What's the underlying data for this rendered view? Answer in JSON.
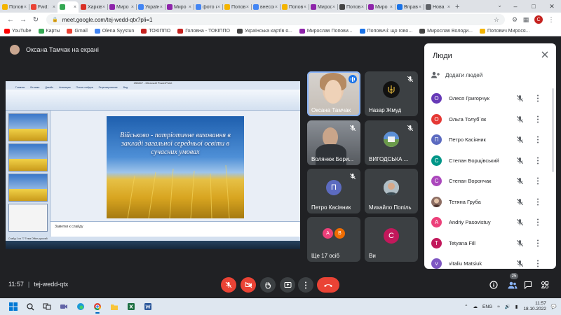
{
  "browser": {
    "tabs": [
      {
        "label": "Попов",
        "color": "#f4b400"
      },
      {
        "label": "Fwd:",
        "color": "#ea4335"
      },
      {
        "label": "",
        "color": "#34a853",
        "active": true
      },
      {
        "label": "Харків",
        "color": "#d93025"
      },
      {
        "label": "Миро",
        "color": "#8e24aa"
      },
      {
        "label": "Україн",
        "color": "#4285f4"
      },
      {
        "label": "Миро",
        "color": "#8e24aa"
      },
      {
        "label": "фото к",
        "color": "#4285f4"
      },
      {
        "label": "Попов",
        "color": "#f4b400"
      },
      {
        "label": "внесок",
        "color": "#4285f4"
      },
      {
        "label": "Попов",
        "color": "#f4b400"
      },
      {
        "label": "Мирос",
        "color": "#8e24aa"
      },
      {
        "label": "Попов",
        "color": "#444444"
      },
      {
        "label": "Миро",
        "color": "#8e24aa"
      },
      {
        "label": "Вправ",
        "color": "#1a73e8"
      },
      {
        "label": "Нова",
        "color": "#5f6368"
      }
    ],
    "tab_close": "×",
    "new_tab": "+",
    "url": "meet.google.com/tej-wedd-qtx?pli=1",
    "profile_initial": "C",
    "bookmarks": [
      {
        "label": "YouTube",
        "color": "#ff0000"
      },
      {
        "label": "Карты",
        "color": "#34a853"
      },
      {
        "label": "Gmail",
        "color": "#ea4335"
      },
      {
        "label": "Olena Syystun",
        "color": "#4285f4"
      },
      {
        "label": "ТОКІППО",
        "color": "#c5221f"
      },
      {
        "label": "Головна - ТОКІППО",
        "color": "#c5221f"
      },
      {
        "label": "Українська картів я...",
        "color": "#444444"
      },
      {
        "label": "Мирослав Попови...",
        "color": "#8e24aa"
      },
      {
        "label": "Поповичі: що гово...",
        "color": "#1a73e8"
      },
      {
        "label": "Мирослав Володи...",
        "color": "#444444"
      },
      {
        "label": "Попович Мирося...",
        "color": "#f4b400"
      }
    ]
  },
  "meet": {
    "presenter_label": "Оксана Тамчак на екрані",
    "meeting_time": "11:57",
    "meeting_code": "tej-wedd-qtx",
    "participants_count": "25",
    "accent_color": "#1a73e8",
    "danger_color": "#ea4335"
  },
  "shared_screen": {
    "ppt_window_title": "250847 - Microsoft PowerPoint",
    "ppt_tabs": [
      "Главная",
      "Вставка",
      "Дизайн",
      "Анимация",
      "Показ слайдов",
      "Рецензирование",
      "Вид"
    ],
    "slide_text": "Військово - патріотичне виховання в закладі загальної середньої освіти в сучасних умовах",
    "notes_placeholder": "Заметки к слайду",
    "status_text": "Слайд 1 из 77    Тема Office    русский"
  },
  "tiles": [
    {
      "name": "Оксана Тамчак",
      "kind": "video",
      "speaking": true
    },
    {
      "name": "Назар Жмуд",
      "kind": "emblem"
    },
    {
      "name": "Волянюк Бори...",
      "kind": "video2"
    },
    {
      "name": "ВИГОДСЬКА ...",
      "kind": "photo"
    },
    {
      "name": "Петро Касіяник",
      "kind": "avatar",
      "initial": "П",
      "color": "#5c6bc0"
    },
    {
      "name": "Михайло Попіль",
      "kind": "photo2"
    },
    {
      "name": "Ще 17 осіб",
      "kind": "more",
      "initials": [
        "A",
        "В"
      ]
    },
    {
      "name": "Ви",
      "kind": "avatar",
      "initial": "С",
      "color": "#c2185b"
    }
  ],
  "people_panel": {
    "title": "Люди",
    "add_people": "Додати людей",
    "list": [
      {
        "name": "Олеся Григорчук",
        "initial": "О",
        "color": "#673ab7"
      },
      {
        "name": "Ольга Толуб`як",
        "initial": "О",
        "color": "#e53935"
      },
      {
        "name": "Петро Касіяник",
        "initial": "П",
        "color": "#5c6bc0"
      },
      {
        "name": "Степан Борщівський",
        "initial": "С",
        "color": "#009688"
      },
      {
        "name": "Степан Ворончак",
        "initial": "С",
        "color": "#ab47bc"
      },
      {
        "name": "Тетяна Груба",
        "initial": "",
        "color": "#8d6e63",
        "photo": true
      },
      {
        "name": "Andriy Pasovistuy",
        "initial": "A",
        "color": "#ec407a"
      },
      {
        "name": "Tetyana Fill",
        "initial": "T",
        "color": "#c2185b"
      },
      {
        "name": "vitaliu Matsiuk",
        "initial": "v",
        "color": "#7e57c2"
      }
    ]
  },
  "taskbar": {
    "tray_lang": "ENG",
    "time": "11:57",
    "date": "18.10.2022"
  }
}
